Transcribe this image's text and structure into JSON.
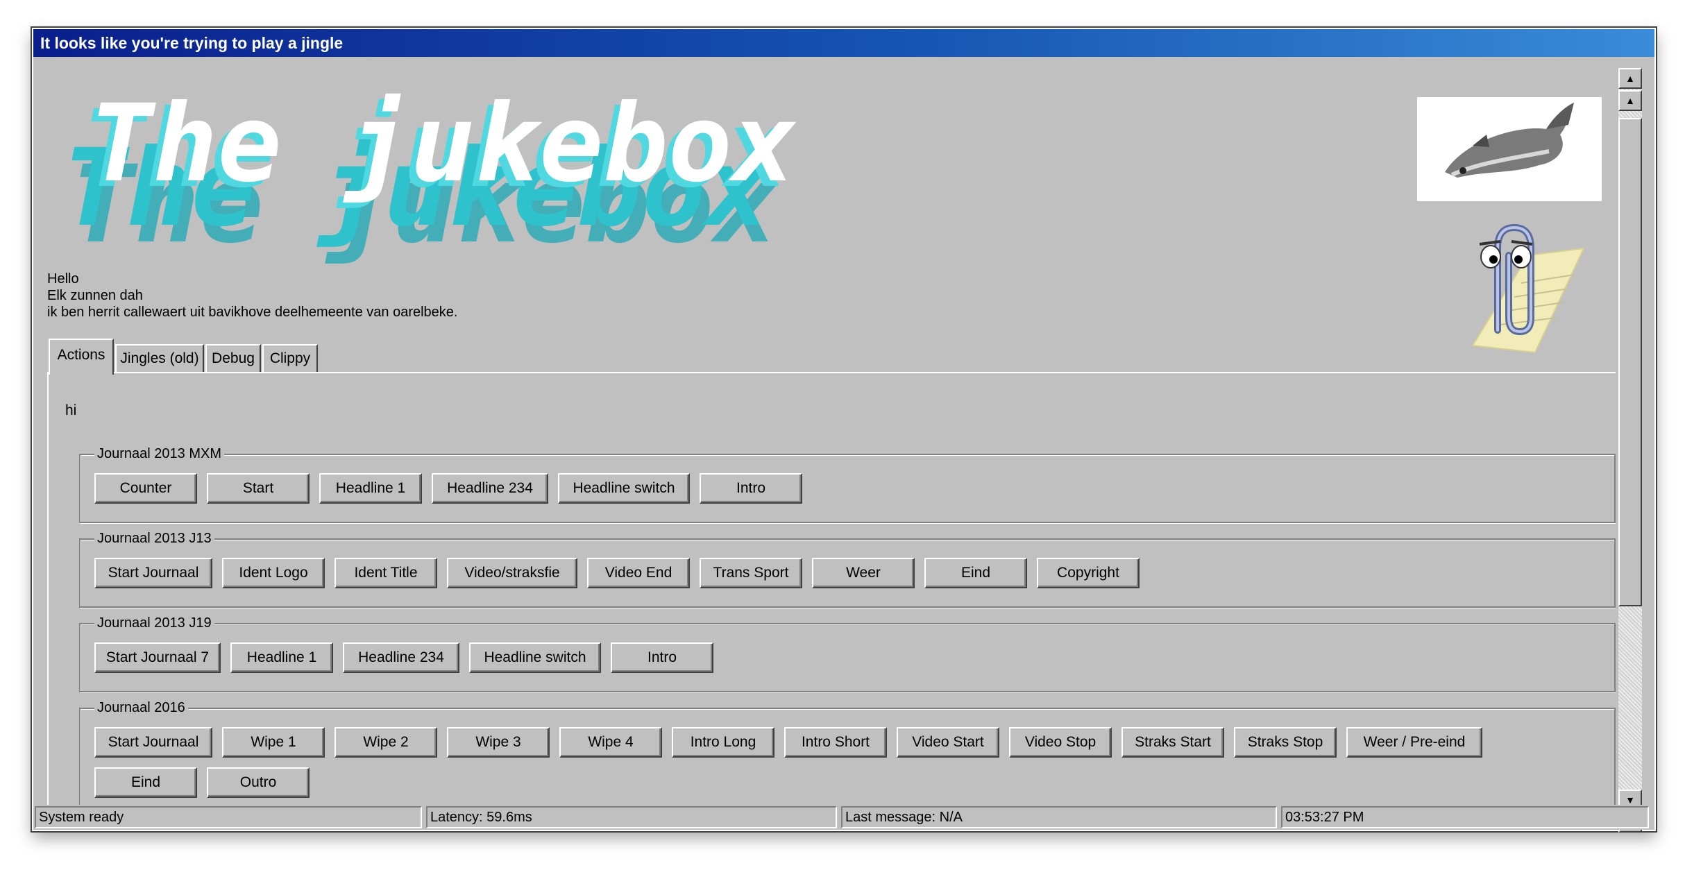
{
  "window": {
    "title": "It looks like you're trying to play a jingle"
  },
  "header": {
    "logo_text": "The jukebox",
    "greeting": [
      "Hello",
      "Elk zunnen dah",
      "ik ben herrit callewaert uit bavikhove deelhemeente van oarelbeke."
    ]
  },
  "tabs": [
    {
      "label": "Actions",
      "active": true
    },
    {
      "label": "Jingles (old)",
      "active": false
    },
    {
      "label": "Debug",
      "active": false
    },
    {
      "label": "Clippy",
      "active": false
    }
  ],
  "panel": {
    "intro": "hi",
    "groups": [
      {
        "title": "Journaal 2013 MXM",
        "buttons": [
          "Counter",
          "Start",
          "Headline 1",
          "Headline 234",
          "Headline switch",
          "Intro"
        ]
      },
      {
        "title": "Journaal 2013 J13",
        "buttons": [
          "Start Journaal",
          "Ident Logo",
          "Ident Title",
          "Video/straksfie",
          "Video End",
          "Trans Sport",
          "Weer",
          "Eind",
          "Copyright"
        ]
      },
      {
        "title": "Journaal 2013 J19",
        "buttons": [
          "Start Journaal 7",
          "Headline 1",
          "Headline 234",
          "Headline switch",
          "Intro"
        ]
      },
      {
        "title": "Journaal 2016",
        "buttons": [
          "Start Journaal",
          "Wipe 1",
          "Wipe 2",
          "Wipe 3",
          "Wipe 4",
          "Intro Long",
          "Intro Short",
          "Video Start",
          "Video Stop",
          "Straks Start",
          "Straks Stop",
          "Weer / Pre-eind",
          "Eind",
          "Outro"
        ]
      }
    ]
  },
  "scrollbar": {
    "up_icon": "▲",
    "down_icon": "▼"
  },
  "status": {
    "state": "System ready",
    "latency": "Latency: 59.6ms",
    "last_message": "Last message: N/A",
    "clock": "03:53:27 PM"
  },
  "icons": {
    "fish": "fish-image",
    "clippy": "paperclip-assistant-image"
  },
  "colors": {
    "title_gradient_start": "#0a1e8c",
    "title_gradient_end": "#3a8bd8",
    "logo_cyan": "#4fd8e0",
    "logo_teal": "#1aa8b4",
    "face": "#c0c0c0"
  }
}
